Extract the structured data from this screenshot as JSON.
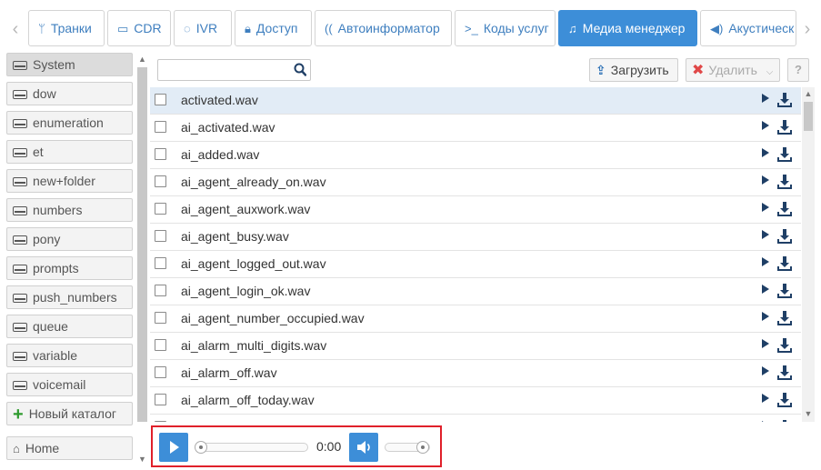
{
  "tabs": [
    {
      "label": "Транки",
      "icon": "fork-icon",
      "active": false
    },
    {
      "label": "CDR",
      "icon": "card-icon",
      "active": false
    },
    {
      "label": "IVR",
      "icon": "comments-icon",
      "active": false
    },
    {
      "label": "Доступ",
      "icon": "lock-icon",
      "active": false
    },
    {
      "label": "Автоинформатор",
      "icon": "phone-signal-icon",
      "active": false
    },
    {
      "label": "Коды услуг",
      "icon": "terminal-icon",
      "active": false
    },
    {
      "label": "Медиа менеджер",
      "icon": "music-icon",
      "active": true
    },
    {
      "label": "Акустическ",
      "icon": "volume-icon",
      "active": false
    }
  ],
  "folders": [
    {
      "label": "System",
      "selected": true
    },
    {
      "label": "dow",
      "selected": false
    },
    {
      "label": "enumeration",
      "selected": false
    },
    {
      "label": "et",
      "selected": false
    },
    {
      "label": "new+folder",
      "selected": false
    },
    {
      "label": "numbers",
      "selected": false
    },
    {
      "label": "pony",
      "selected": false
    },
    {
      "label": "prompts",
      "selected": false
    },
    {
      "label": "push_numbers",
      "selected": false
    },
    {
      "label": "queue",
      "selected": false
    },
    {
      "label": "variable",
      "selected": false
    },
    {
      "label": "voicemail",
      "selected": false
    }
  ],
  "new_folder_label": "Новый каталог",
  "home_label": "Home",
  "search": {
    "value": "",
    "placeholder": ""
  },
  "toolbar": {
    "upload_label": "Загрузить",
    "delete_label": "Удалить",
    "help_label": "?"
  },
  "files": [
    "activated.wav",
    "ai_activated.wav",
    "ai_added.wav",
    "ai_agent_already_on.wav",
    "ai_agent_auxwork.wav",
    "ai_agent_busy.wav",
    "ai_agent_logged_out.wav",
    "ai_agent_login_ok.wav",
    "ai_agent_number_occupied.wav",
    "ai_alarm_multi_digits.wav",
    "ai_alarm_off.wav",
    "ai_alarm_off_today.wav",
    ""
  ],
  "player": {
    "time": "0:00",
    "progress": 0,
    "volume": 1.0
  },
  "colors": {
    "accent": "#3d8ed8",
    "highlight_row": "#e2ecf6",
    "player_border": "#e0202a",
    "new_folder_plus": "#2e9b2e"
  }
}
